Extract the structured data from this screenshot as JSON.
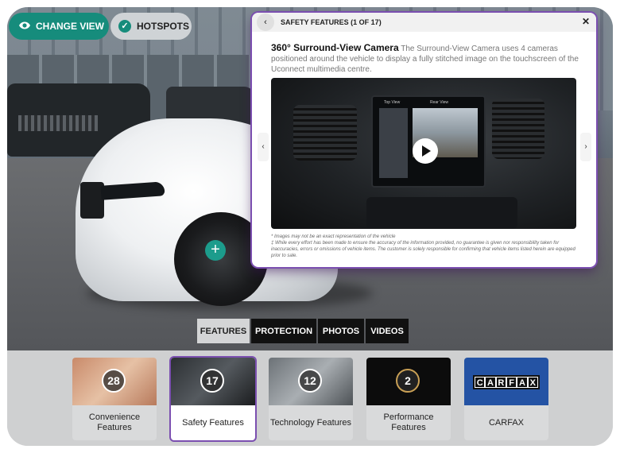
{
  "top_buttons": {
    "change_view": "CHANGE VIEW",
    "hotspots": "HOTSPOTS"
  },
  "popup": {
    "title": "SAFETY FEATURES (1 OF 17)",
    "feature_name": "360° Surround-View Camera",
    "feature_desc": "The Surround-View Camera uses 4 cameras positioned around the vehicle to display a fully stitched image on the touchscreen of the Uconnect multimedia centre.",
    "screen_top_view": "Top View",
    "screen_rear_view": "Rear View",
    "note1": "* Images may not be an exact representation of the vehicle",
    "note2": "‡ While every effort has been made to ensure the accuracy of the information provided, no guarantee is given nor responsibility taken for inaccuracies, errors or omissions of vehicle items. The customer is solely responsible for confirming that vehicle items listed herein are equipped prior to sale."
  },
  "tabs": [
    "FEATURES",
    "PROTECTION",
    "PHOTOS",
    "VIDEOS"
  ],
  "active_tab": "FEATURES",
  "cards": [
    {
      "count": "28",
      "label": "Convenience Features"
    },
    {
      "count": "17",
      "label": "Safety Features",
      "selected": true
    },
    {
      "count": "12",
      "label": "Technology Features"
    },
    {
      "count": "2",
      "label": "Performance Features"
    },
    {
      "count": "",
      "label": "CARFAX",
      "logo_text": "CARFAX"
    }
  ],
  "colors": {
    "accent_teal": "#168c7c",
    "selected_purple": "#7b4fb0",
    "tab_dark": "#111111"
  },
  "icons": {
    "change_view": "eye-icon",
    "hotspots": "check-circle-icon",
    "back": "chevron-left-icon",
    "close": "close-icon",
    "hotspot": "plus-icon",
    "play": "play-icon"
  }
}
